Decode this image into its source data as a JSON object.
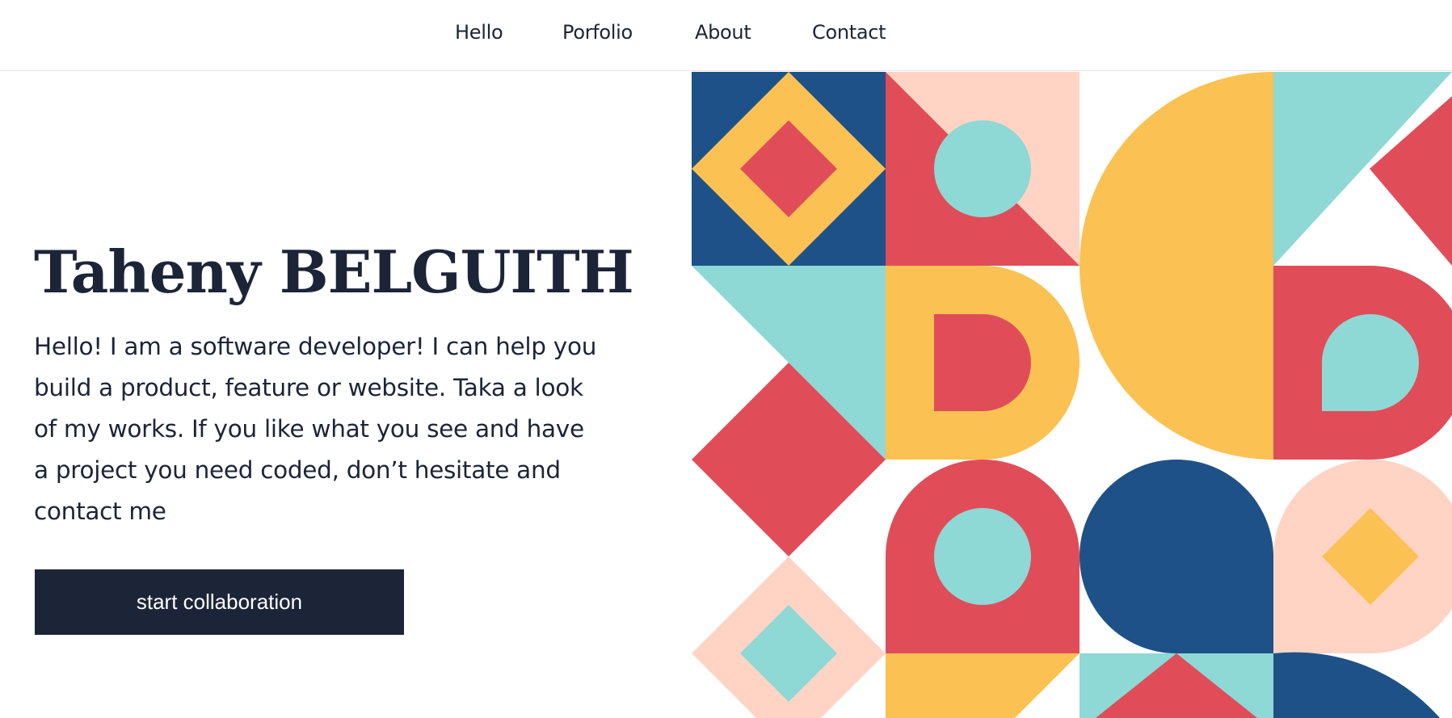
{
  "nav": {
    "links": [
      {
        "label": "Hello"
      },
      {
        "label": "Porfolio"
      },
      {
        "label": "About"
      },
      {
        "label": "Contact"
      }
    ]
  },
  "hero": {
    "title": "Taheny BELGUITH",
    "intro": "Hello! I am a software developer! I can help you build a product, feature or website. Taka a look of my works. If you like what you see and have a project you need coded, don’t hesitate and contact me",
    "cta_label": "start collaboration"
  },
  "colors": {
    "navy": "#1e5188",
    "yellow": "#fcc153",
    "red": "#e04d59",
    "teal": "#8ed8d5",
    "peach": "#ffd4c5",
    "text": "#1c2438"
  }
}
